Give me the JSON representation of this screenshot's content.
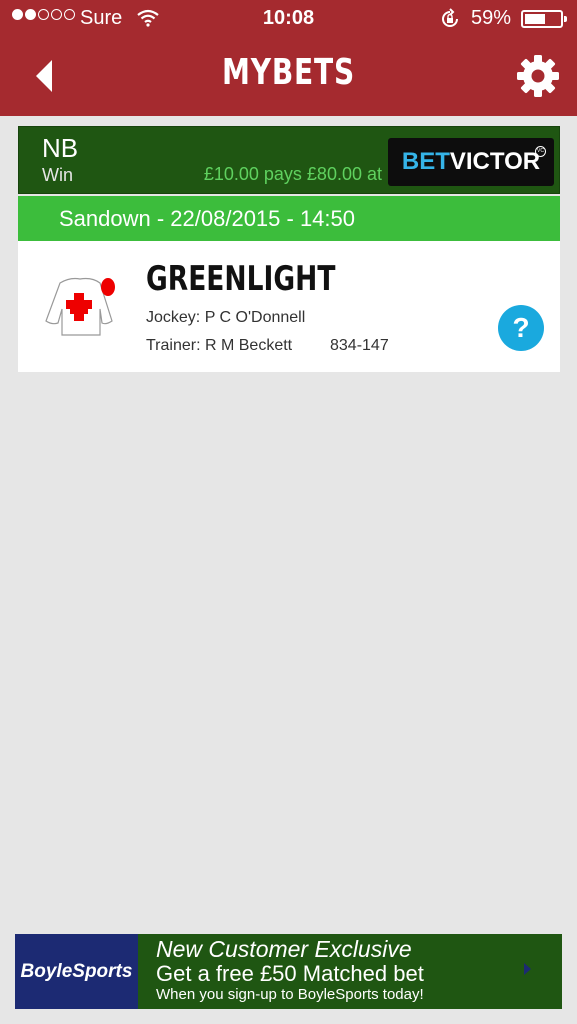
{
  "status_bar": {
    "carrier": "Sure",
    "time": "10:08",
    "battery": "59%",
    "battery_level": 0.59,
    "signal_bars_filled": 2,
    "signal_bars_total": 5
  },
  "header": {
    "title": "MYBETS",
    "back_icon": "chevron-left-icon",
    "settings_icon": "gear-icon",
    "background": "#a52a2f"
  },
  "bet": {
    "code": "NB",
    "type": "Win",
    "pays": "£10.00 pays £80.00 at",
    "bookmaker": {
      "part1": "BET",
      "part2": "VICTOR",
      "badge": "VC"
    },
    "race": "Sandown - 22/08/2015 - 14:50",
    "runner": {
      "name": "GREENLIGHT",
      "jockey": "Jockey: P C O'Donnell",
      "trainer": "Trainer: R M Beckett",
      "form": "834-147",
      "help": "?"
    }
  },
  "ad": {
    "brand": "BoyleSports",
    "headline": "New Customer Exclusive",
    "offer": "Get a free £50 Matched bet",
    "subtext": "When you sign-up to BoyleSports today!"
  },
  "colors": {
    "header_red": "#a52a2f",
    "dark_green": "#1f5612",
    "bright_green": "#3cbd3c",
    "help_blue": "#1aa9de"
  }
}
